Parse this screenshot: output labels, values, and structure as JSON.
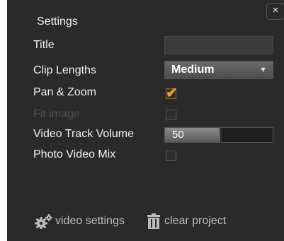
{
  "panel": {
    "heading": "Settings",
    "close_glyph": "×"
  },
  "rows": {
    "title": {
      "label": "Title",
      "value": ""
    },
    "clip_lengths": {
      "label": "Clip Lengths",
      "value": "Medium",
      "arrow": "▼"
    },
    "pan_zoom": {
      "label": "Pan & Zoom",
      "checked": true,
      "check_glyph": "✔"
    },
    "fit_image": {
      "label": "Fit image",
      "checked": false,
      "disabled": true
    },
    "video_track_volume": {
      "label": "Video Track Volume",
      "value": "50",
      "level_fraction": 0.5
    },
    "photo_video_mix": {
      "label": "Photo Video Mix",
      "checked": false
    }
  },
  "footer": {
    "video_settings_label": "video settings",
    "clear_project_label": "clear project"
  },
  "colors": {
    "panel_bg": "#2a2a2a",
    "accent_check": "#f0a020",
    "disabled_text": "#505050"
  },
  "icons": {
    "close": "close-icon",
    "settings": "gear-icon",
    "clear": "trash-icon"
  }
}
